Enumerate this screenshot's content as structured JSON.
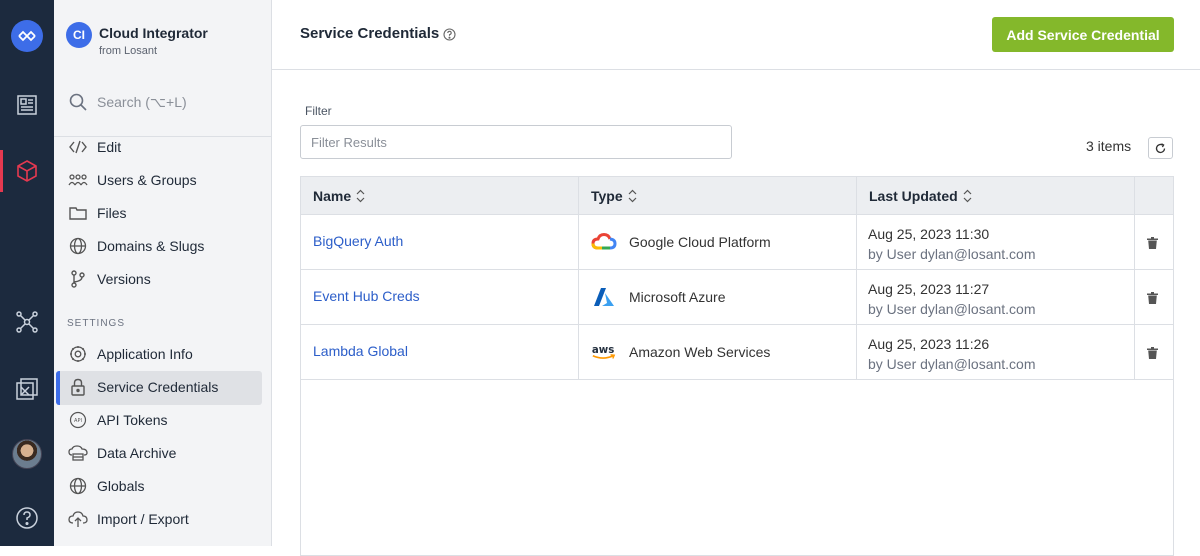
{
  "app": {
    "badge": "CI",
    "name": "Cloud Integrator",
    "subtitle": "from Losant"
  },
  "search": {
    "label": "Search (⌥+L)"
  },
  "nav": {
    "items": [
      {
        "label": "Edit",
        "icon": "code-icon"
      },
      {
        "label": "Users & Groups",
        "icon": "users-icon"
      },
      {
        "label": "Files",
        "icon": "folder-icon"
      },
      {
        "label": "Domains & Slugs",
        "icon": "globe-icon"
      },
      {
        "label": "Versions",
        "icon": "branch-icon"
      }
    ],
    "settings_label": "SETTINGS",
    "settings_items": [
      {
        "label": "Application Info",
        "icon": "gear-icon"
      },
      {
        "label": "Service Credentials",
        "icon": "lock-icon",
        "active": true
      },
      {
        "label": "API Tokens",
        "icon": "api-icon"
      },
      {
        "label": "Data Archive",
        "icon": "archive-icon"
      },
      {
        "label": "Globals",
        "icon": "globe-icon"
      },
      {
        "label": "Import / Export",
        "icon": "cloud-upload-icon"
      }
    ]
  },
  "header": {
    "title": "Service Credentials",
    "add_button": "Add Service Credential"
  },
  "filter": {
    "label": "Filter",
    "placeholder": "Filter Results"
  },
  "count": "3 items",
  "table": {
    "columns": [
      "Name",
      "Type",
      "Last Updated"
    ],
    "rows": [
      {
        "name": "BigQuery Auth",
        "type": "Google Cloud Platform",
        "type_icon": "google-cloud-icon",
        "date": "Aug 25, 2023 11:30",
        "by": "by User dylan@losant.com"
      },
      {
        "name": "Event Hub Creds",
        "type": "Microsoft Azure",
        "type_icon": "azure-icon",
        "date": "Aug 25, 2023 11:27",
        "by": "by User dylan@losant.com"
      },
      {
        "name": "Lambda Global",
        "type": "Amazon Web Services",
        "type_icon": "aws-icon",
        "date": "Aug 25, 2023 11:26",
        "by": "by User dylan@losant.com"
      }
    ]
  },
  "colors": {
    "accent": "#3d6de8",
    "add_button": "#84b82b",
    "rail": "#1c2a3e",
    "link": "#2c5ec9"
  }
}
